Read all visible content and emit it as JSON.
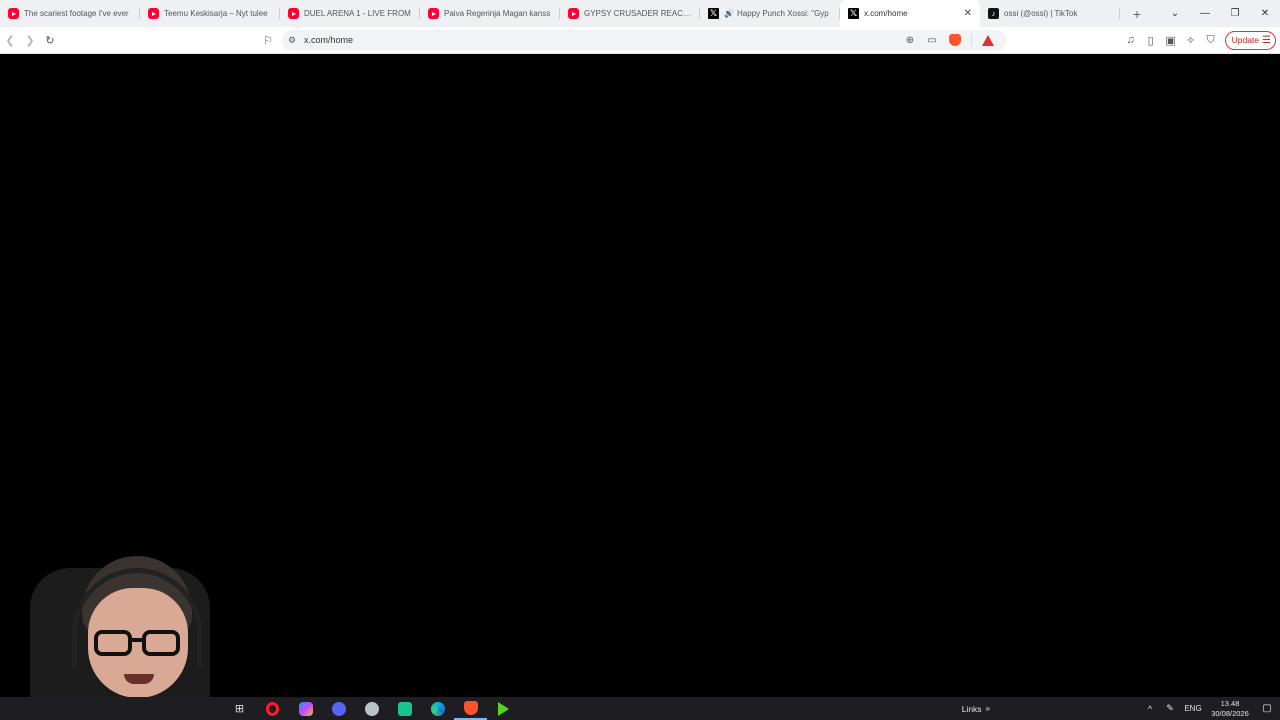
{
  "tabs": [
    {
      "title": "The scariest footage I've ever",
      "favicon": "youtube-icon",
      "active": false
    },
    {
      "title": "Teemu Keskisarja – Nyt tulee",
      "favicon": "youtube-icon",
      "active": false
    },
    {
      "title": "DUEL ARENA 1 - LIVE FROM",
      "favicon": "youtube-icon",
      "active": false
    },
    {
      "title": "Paiva Regerinja Magan kanss",
      "favicon": "youtube-icon",
      "active": false
    },
    {
      "title": "GYPSY CRUSADER REACTS TO",
      "favicon": "youtube-icon",
      "active": false
    },
    {
      "title": "Happy Punch Xossi: \"Gyp",
      "favicon": "x-icon",
      "active": false,
      "audio": true
    },
    {
      "title": "x.com/home",
      "favicon": "x-icon",
      "active": true
    },
    {
      "title": "ossi (@ossi) | TikTok",
      "favicon": "tiktok-icon",
      "active": false
    }
  ],
  "toolbar": {
    "url": "x.com/home",
    "update_label": "Update"
  },
  "taskbar": {
    "links_label": "Links",
    "language": "ENG",
    "time": "13.48",
    "date": "30/08/2026"
  },
  "colors": {
    "tabstrip_bg": "#eef0f3",
    "content_bg": "#000000",
    "taskbar_bg": "#1e1e22",
    "update_accent": "#c22222"
  }
}
